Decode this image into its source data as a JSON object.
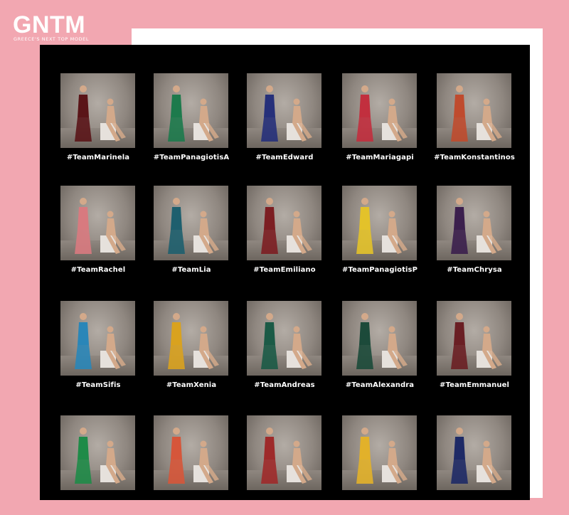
{
  "brand": {
    "logo_text": "GNTM",
    "logo_subtitle": "GREECE'S NEXT TOP MODEL"
  },
  "teams": [
    {
      "label": "#TeamMarinela",
      "garment_color": "#5a1518"
    },
    {
      "label": "#TeamPanagiotisA",
      "garment_color": "#1d7a4c"
    },
    {
      "label": "#TeamEdward",
      "garment_color": "#26307a"
    },
    {
      "label": "#TeamMariagapi",
      "garment_color": "#c22f3e"
    },
    {
      "label": "#TeamKonstantinos",
      "garment_color": "#bf4b2e"
    },
    {
      "label": "#TeamRachel",
      "garment_color": "#d87a7f"
    },
    {
      "label": "#TeamLia",
      "garment_color": "#1e5f6e"
    },
    {
      "label": "#TeamEmiliano",
      "garment_color": "#7c1e22"
    },
    {
      "label": "#TeamPanagiotisP",
      "garment_color": "#e3c22a"
    },
    {
      "label": "#TeamChrysa",
      "garment_color": "#3b1f4d"
    },
    {
      "label": "#TeamSifis",
      "garment_color": "#2a86b8"
    },
    {
      "label": "#TeamXenia",
      "garment_color": "#d9a21f"
    },
    {
      "label": "#TeamAndreas",
      "garment_color": "#1b5a46"
    },
    {
      "label": "#TeamAlexandra",
      "garment_color": "#1c4a3a"
    },
    {
      "label": "#TeamEmmanuel",
      "garment_color": "#6a1f24"
    },
    {
      "label": "",
      "garment_color": "#1f8b48"
    },
    {
      "label": "",
      "garment_color": "#d6563a"
    },
    {
      "label": "",
      "garment_color": "#9e2a2a"
    },
    {
      "label": "",
      "garment_color": "#e2b12a"
    },
    {
      "label": "",
      "garment_color": "#1e2a66"
    }
  ]
}
